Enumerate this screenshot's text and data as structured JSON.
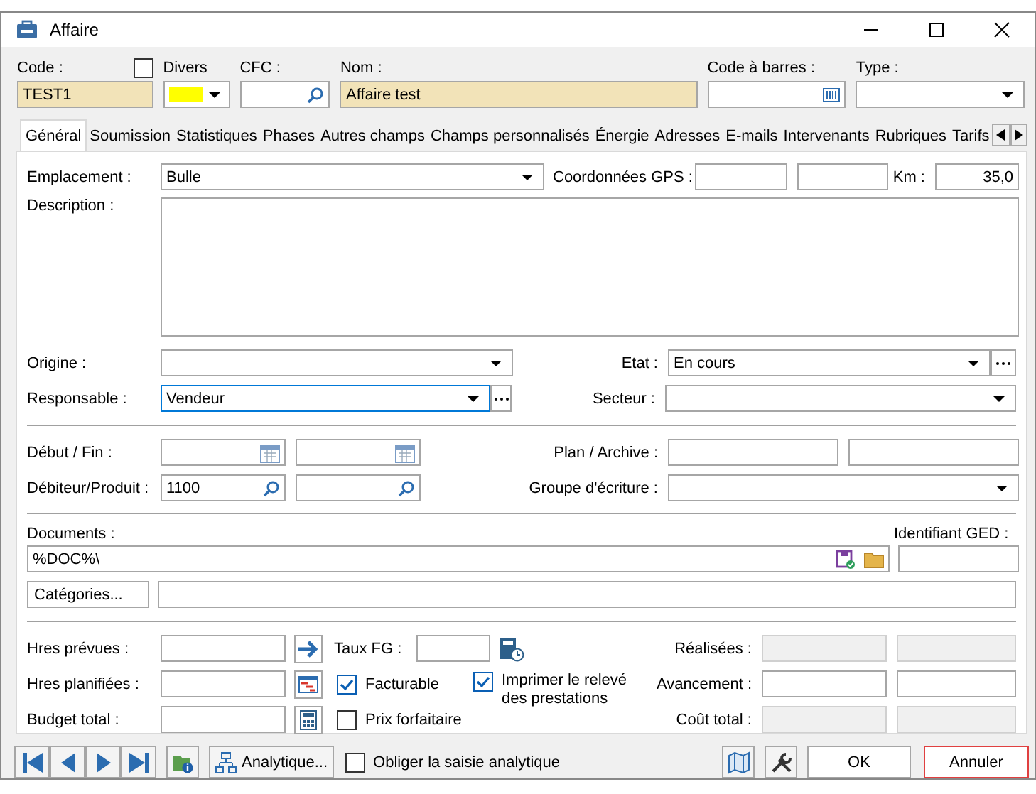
{
  "window": {
    "title": "Affaire"
  },
  "header": {
    "code": {
      "label": "Code :",
      "value": "TEST1",
      "required": true
    },
    "flag": {
      "checked": false
    },
    "divers": {
      "label": "Divers",
      "color": "#ffff00"
    },
    "cfc": {
      "label": "CFC :"
    },
    "nom": {
      "label": "Nom :",
      "value": "Affaire test",
      "required": true
    },
    "barcode": {
      "label": "Code à barres :"
    },
    "type": {
      "label": "Type :"
    }
  },
  "tabs": [
    {
      "label": "Général",
      "selected": true
    },
    {
      "label": "Soumission",
      "selected": false
    },
    {
      "label": "Statistiques",
      "selected": false
    },
    {
      "label": "Phases",
      "selected": false
    },
    {
      "label": "Autres champs",
      "selected": false
    },
    {
      "label": "Champs personnalisés",
      "selected": false
    },
    {
      "label": "Énergie",
      "selected": false
    },
    {
      "label": "Adresses",
      "selected": false
    },
    {
      "label": "E-mails",
      "selected": false
    },
    {
      "label": "Intervenants",
      "selected": false
    },
    {
      "label": "Rubriques",
      "selected": false
    },
    {
      "label": "Tarifs",
      "selected": false
    }
  ],
  "general": {
    "emplacement": {
      "label": "Emplacement :",
      "value": "Bulle"
    },
    "gps": {
      "label": "Coordonnées GPS :"
    },
    "km": {
      "label": "Km :",
      "value": "35,0"
    },
    "description": {
      "label": "Description :"
    },
    "origine": {
      "label": "Origine :"
    },
    "etat": {
      "label": "Etat :",
      "value": "En cours"
    },
    "responsable": {
      "label": "Responsable :",
      "value": "Vendeur",
      "focused": true
    },
    "secteur": {
      "label": "Secteur :"
    },
    "debut_fin": {
      "label": "Début / Fin :"
    },
    "plan_archive": {
      "label": "Plan / Archive :"
    },
    "debiteur_produit": {
      "label": "Débiteur/Produit :",
      "value": "1100"
    },
    "groupe_ecriture": {
      "label": "Groupe d'écriture :"
    },
    "documents": {
      "label": "Documents :",
      "value": "%DOC%\\"
    },
    "ged": {
      "label": "Identifiant GED :"
    },
    "categories": {
      "button": "Catégories..."
    },
    "hres_prevues": {
      "label": "Hres prévues :"
    },
    "taux_fg": {
      "label": "Taux FG :"
    },
    "hres_planifiees": {
      "label": "Hres planifiées :"
    },
    "budget_total": {
      "label": "Budget total :"
    },
    "checks": [
      {
        "label": "Facturable",
        "checked": true
      },
      {
        "label": "Prix forfaitaire",
        "checked": false
      },
      {
        "label": "Imprimer le relevé des prestations",
        "checked": true
      }
    ],
    "totals": [
      {
        "label": "Réalisées :",
        "disabled": true
      },
      {
        "label": "Avancement :",
        "disabled": false
      },
      {
        "label": "Coût total :",
        "disabled": true
      }
    ]
  },
  "footer": {
    "analytique": "Analytique...",
    "force": {
      "label": "Obliger la saisie analytique",
      "checked": false
    },
    "ok": "OK",
    "cancel": "Annuler"
  }
}
